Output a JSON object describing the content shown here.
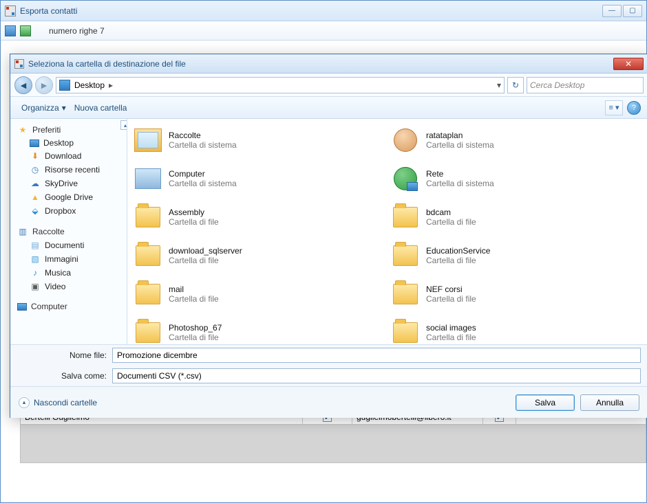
{
  "parent": {
    "title": "Esporta contatti",
    "row_count_label": "numero righe 7"
  },
  "grid": {
    "name": "Bertelli Guglielmo",
    "email": "guglielmobertelli@libero.it"
  },
  "dialog": {
    "title": "Seleziona la cartella di destinazione del file",
    "breadcrumb": "Desktop",
    "search_placeholder": "Cerca Desktop",
    "cmd_organize": "Organizza",
    "cmd_newfolder": "Nuova cartella",
    "sidebar": {
      "favorites": "Preferiti",
      "desktop": "Desktop",
      "download": "Download",
      "recent": "Risorse recenti",
      "skydrive": "SkyDrive",
      "gdrive": "Google Drive",
      "dropbox": "Dropbox",
      "libraries": "Raccolte",
      "documents": "Documenti",
      "images": "Immagini",
      "music": "Musica",
      "video": "Video",
      "computer": "Computer"
    },
    "items": {
      "type_system": "Cartella di sistema",
      "type_file": "Cartella di file",
      "raccolte": "Raccolte",
      "ratataplan": "ratataplan",
      "computer": "Computer",
      "rete": "Rete",
      "assembly": "Assembly",
      "bdcam": "bdcam",
      "download_sql": "download_sqlserver",
      "education": "EducationService",
      "mail": "mail",
      "nef": "NEF corsi",
      "photoshop": "Photoshop_67",
      "social": "social images"
    },
    "filename_label": "Nome file:",
    "filename_value": "Promozione dicembre",
    "saveas_label": "Salva come:",
    "saveas_value": "Documenti CSV (*.csv)",
    "hide_folders": "Nascondi cartelle",
    "btn_save": "Salva",
    "btn_cancel": "Annulla"
  }
}
